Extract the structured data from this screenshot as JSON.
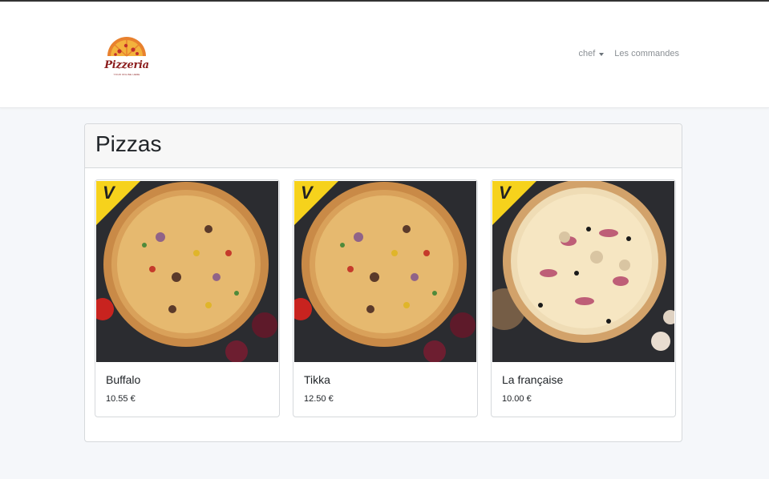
{
  "brand": {
    "name": "Pizzeria",
    "tagline": "YOUR ONLINE HERE"
  },
  "nav": {
    "user_menu": "chef",
    "orders_link": "Les commandes"
  },
  "main": {
    "title": "Pizzas"
  },
  "pizzas": [
    {
      "name": "Buffalo",
      "price": "10.55 €",
      "badge": "V",
      "style": "red"
    },
    {
      "name": "Tikka",
      "price": "12.50 €",
      "badge": "V",
      "style": "red"
    },
    {
      "name": "La française",
      "price": "10.00 €",
      "badge": "V",
      "style": "white"
    }
  ],
  "colors": {
    "badge": "#f6d21c",
    "crust": "#d8934a",
    "accent": "#8b1d1d"
  }
}
